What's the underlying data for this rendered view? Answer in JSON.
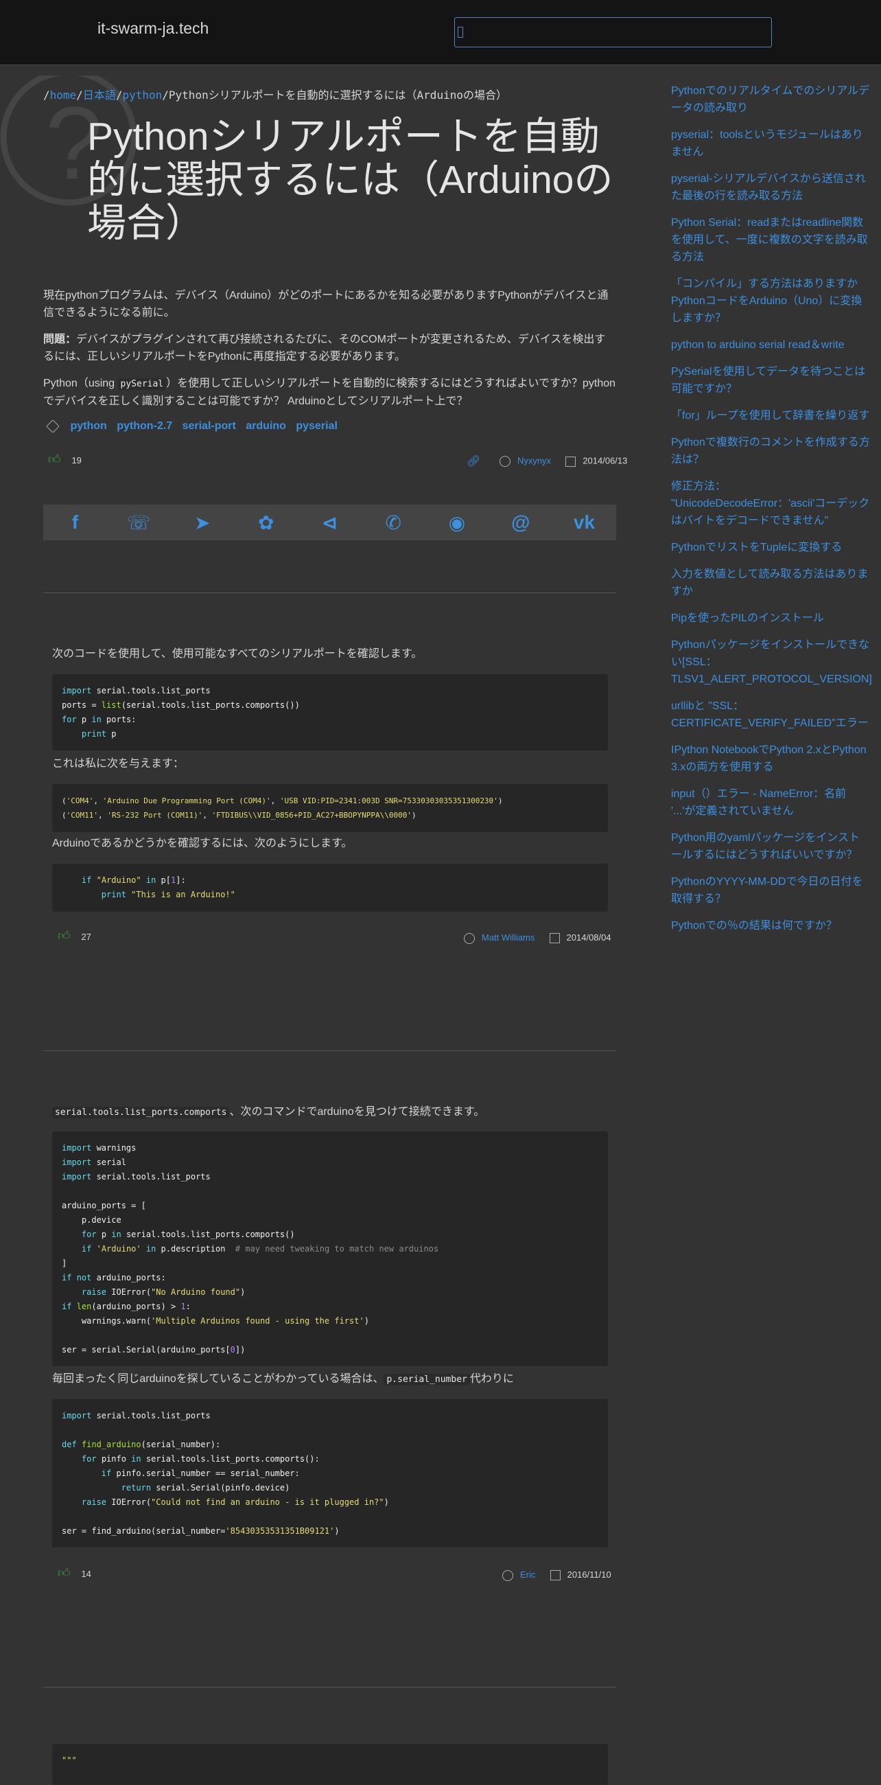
{
  "header": {
    "site_title": "it-swarm-ja.tech",
    "search_placeholder": ""
  },
  "breadcrumb": {
    "home": "home",
    "lang": "日本語",
    "section": "python",
    "current": "Pythonシリアルポートを自動的に選択するには（Arduinoの場合）",
    "sep": "/"
  },
  "question": {
    "title": "Pythonシリアルポートを自動的に選択するには（Arduinoの場合）",
    "p1": "現在pythonプログラムは、デバイス（Arduino）がどのポートにあるかを知る必要がありますPythonがデバイスと通信できるようになる前に。",
    "p2_label": "問題：",
    "p2": "デバイスがプラグインされて再び接続されるたびに、そのCOMポートが変更されるため、デバイスを検出するには、正しいシリアルポートをPythonに再度指定する必要があります。",
    "p3_a": "Python（using ",
    "p3_code": "pySerial",
    "p3_b": "）を使用して正しいシリアルポートを自動的に検索するにはどうすればよいですか？pythonでデバイスを正しく識別することは可能ですか？ Arduinoとしてシリアルポート上で？",
    "tags": [
      "python",
      "python-2.7",
      "serial-port",
      "arduino",
      "pyserial"
    ],
    "votes": "19",
    "author": "Nyxynyx",
    "date": "2014/06/13"
  },
  "share_icons": [
    "facebook-icon",
    "whatsapp-icon",
    "telegram-icon",
    "twitter-icon",
    "share-icon",
    "viber-icon",
    "reddit-icon",
    "email-icon",
    "vk-icon"
  ],
  "answers": [
    {
      "intro": "次のコードを使用して、使用可能なすべてのシリアルポートを確認します。",
      "mid1": "これは私に次を与えます：",
      "mid2": "Arduinoであるかどうかを確認するには、次のようにします。",
      "votes": "27",
      "author": "Matt Williams",
      "date": "2014/08/04"
    },
    {
      "intro_code": "serial.tools.list_ports.comports",
      "intro": "、次のコマンドでarduinoを見つけて接続できます。",
      "mid_a": "毎回まったく同じarduinoを探していることがわかっている場合は、",
      "mid_code": "p.serial_number",
      "mid_b": "代わりに",
      "votes": "14",
      "author": "Eric",
      "date": "2016/11/10"
    }
  ],
  "sidebar": {
    "links": [
      "Pythonでのリアルタイムでのシリアルデータの読み取り",
      "pyserial：toolsというモジュールはありません",
      "pyserial-シリアルデバイスから送信された最後の行を読み取る方法",
      "Python Serial：readまたはreadline関数を使用して、一度に複数の文字を読み取る方法",
      "「コンパイル」する方法はありますかPythonコードをArduino（Uno）に変換しますか？",
      "python to arduino serial read＆write",
      "PySerialを使用してデータを待つことは可能ですか？",
      "「for」ループを使用して辞書を繰り返す",
      "Pythonで複数行のコメントを作成する方法は？",
      "修正方法： \"UnicodeDecodeError：'ascii'コーデックはバイトをデコードできません\"",
      "PythonでリストをTupleに変換する",
      "入力を数値として読み取る方法はありますか",
      "Pipを使ったPILのインストール",
      "Pythonパッケージをインストールできない[SSL：TLSV1_ALERT_PROTOCOL_VERSION]",
      "urllibと \"SSL：CERTIFICATE_VERIFY_FAILED\"エラー",
      "IPython NotebookでPython 2.xとPython 3.xの両方を使用する",
      "input（）エラー - NameError：名前 '...'が定義されていません",
      "Python用のyamlパッケージをインストールするにはどうすればいいですか？",
      "PythonのYYYY-MM-DDで今日の日付を取得する？",
      "Pythonでの％の結果は何ですか？"
    ]
  },
  "footer_snippet": "\"\"\""
}
